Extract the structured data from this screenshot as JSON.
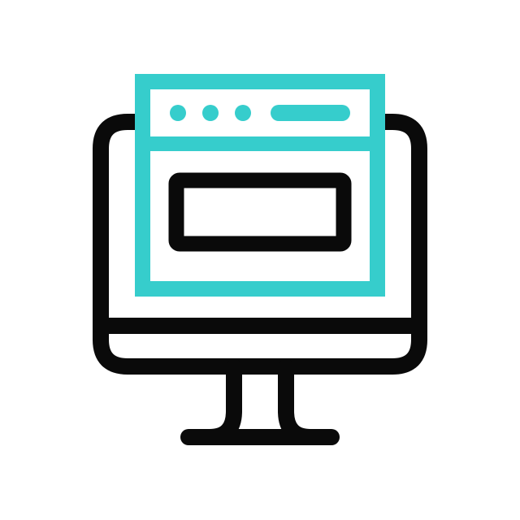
{
  "icon": {
    "name": "monitor-with-browser-window-icon",
    "colors": {
      "background": "#ffffff",
      "outline": "#0a0a0a",
      "accent": "#36cdcc"
    }
  }
}
